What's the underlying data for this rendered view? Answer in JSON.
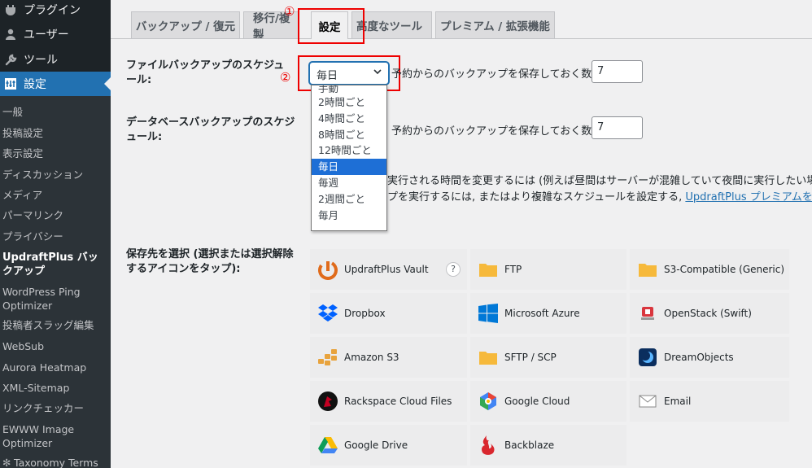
{
  "sidebar": {
    "top_items": [
      {
        "label": "プラグイン",
        "icon": "plugin-icon"
      },
      {
        "label": "ユーザー",
        "icon": "user-icon"
      },
      {
        "label": "ツール",
        "icon": "wrench-icon"
      },
      {
        "label": "設定",
        "icon": "settings-icon"
      }
    ],
    "sub_items": [
      "一般",
      "投稿設定",
      "表示設定",
      "ディスカッション",
      "メディア",
      "パーマリンク",
      "プライバシー",
      "UpdraftPlus バックアップ",
      "WordPress Ping Optimizer",
      "投稿者スラッグ編集",
      "WebSub",
      "Aurora Heatmap",
      "XML-Sitemap",
      "リンクチェッカー",
      "EWWW Image Optimizer",
      "Taxonomy Terms"
    ]
  },
  "tabs": [
    "バックアップ / 復元",
    "移行/複製",
    "設定",
    "高度なツール",
    "プレミアム / 拡張機能"
  ],
  "annotations": {
    "marker1": "①",
    "marker2": "②",
    "color": "#e00000"
  },
  "file_schedule": {
    "label": "ファイルバックアップのスケジュール:",
    "selected": "毎日",
    "retain_text": "予約からのバックアップを保存しておく数:",
    "retain_value": "7"
  },
  "db_schedule": {
    "label": "データベースバックアップのスケジュール:",
    "retain_text": "予約からのバックアップを保存しておく数:",
    "retain_value": "7"
  },
  "dropdown_options": [
    "手動",
    "2時間ごと",
    "4時間ごと",
    "8時間ごと",
    "12時間ごと",
    "毎日",
    "毎週",
    "2週間ごと",
    "毎月"
  ],
  "info": {
    "line1": "実行される時間を変更するには (例えば昼間はサーバーが混雑していて夜間に実行したい場合),",
    "line2": "プを実行するには, またはより複雑なスケジュールを設定する,",
    "link": "UpdraftPlus プレミアムを使用く"
  },
  "storage": {
    "label": "保存先を選択 (選択または選択解除するアイコンをタップ):",
    "help": "?",
    "items": [
      {
        "name": "UpdraftPlus Vault",
        "icon": "updraftplus-vault-icon"
      },
      {
        "name": "FTP",
        "icon": "folder-icon"
      },
      {
        "name": "S3-Compatible (Generic)",
        "icon": "folder-icon"
      },
      {
        "name": "Dropbox",
        "icon": "dropbox-icon"
      },
      {
        "name": "Microsoft Azure",
        "icon": "windows-icon"
      },
      {
        "name": "OpenStack (Swift)",
        "icon": "openstack-icon"
      },
      {
        "name": "Amazon S3",
        "icon": "amazon-s3-icon"
      },
      {
        "name": "SFTP / SCP",
        "icon": "folder-icon"
      },
      {
        "name": "DreamObjects",
        "icon": "dreamobjects-icon"
      },
      {
        "name": "Rackspace Cloud Files",
        "icon": "rackspace-icon"
      },
      {
        "name": "Google Cloud",
        "icon": "google-cloud-icon"
      },
      {
        "name": "Email",
        "icon": "email-icon"
      },
      {
        "name": "Google Drive",
        "icon": "google-drive-icon"
      },
      {
        "name": "Backblaze",
        "icon": "backblaze-icon"
      }
    ]
  },
  "colors": {
    "accent": "#2271b1",
    "sidebar": "#1d2327",
    "highlight": "#1e6fd6",
    "annotation": "#e00000"
  }
}
